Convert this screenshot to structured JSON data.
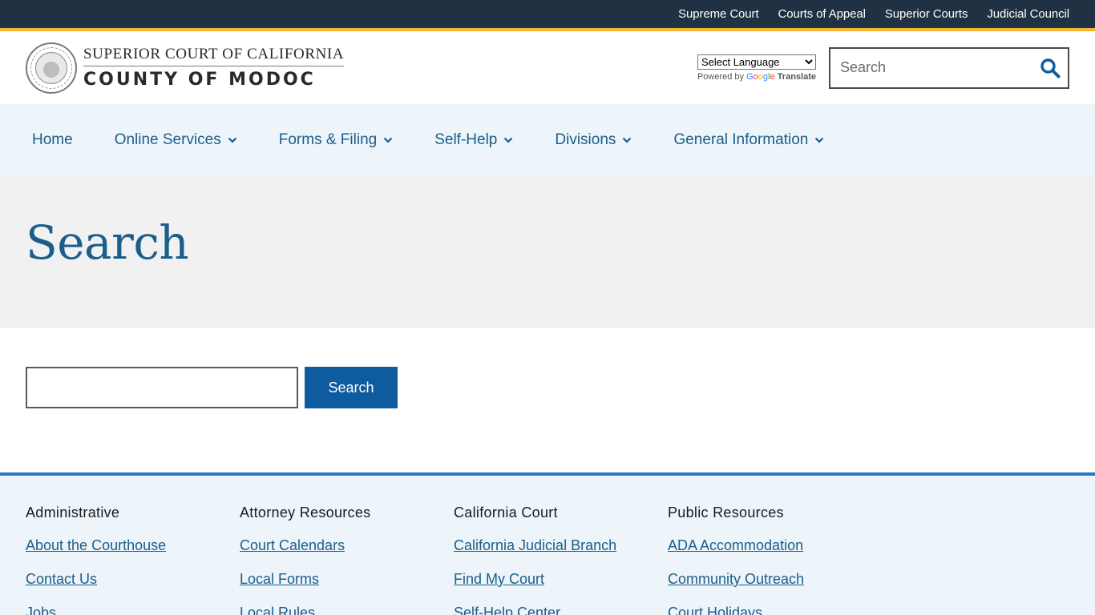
{
  "topbar": {
    "links": [
      "Supreme Court",
      "Courts of Appeal",
      "Superior Courts",
      "Judicial Council"
    ]
  },
  "brand": {
    "line1": "SUPERIOR COURT OF CALIFORNIA",
    "line2": "COUNTY OF MODOC"
  },
  "translate": {
    "select_label": "Select Language",
    "powered_by": "Powered by",
    "translate_word": "Translate"
  },
  "header_search": {
    "placeholder": "Search"
  },
  "nav": {
    "items": [
      {
        "label": "Home"
      },
      {
        "label": "Online Services"
      },
      {
        "label": "Forms & Filing"
      },
      {
        "label": "Self-Help"
      },
      {
        "label": "Divisions"
      },
      {
        "label": "General Information"
      }
    ]
  },
  "hero": {
    "title": "Search"
  },
  "search_form": {
    "value": "",
    "button_label": "Search"
  },
  "footer": {
    "columns": [
      {
        "heading": "Administrative",
        "links": [
          "About the Courthouse",
          "Contact Us",
          "Jobs"
        ]
      },
      {
        "heading": "Attorney Resources",
        "links": [
          "Court Calendars",
          "Local Forms",
          "Local Rules"
        ]
      },
      {
        "heading": "California Court",
        "links": [
          "California Judicial Branch",
          "Find My Court",
          "Self-Help Center"
        ]
      },
      {
        "heading": "Public Resources",
        "links": [
          "ADA Accommodation",
          "Community Outreach",
          "Court Holidays"
        ]
      }
    ]
  },
  "colors": {
    "topbar_bg": "#1f3142",
    "gold_accent": "#f2b632",
    "primary_blue": "#1b5e8a",
    "button_blue": "#0e5ba0",
    "nav_bg": "#edf4fa",
    "hero_bg": "#f1f1f1",
    "footer_border": "#2a78c4"
  }
}
